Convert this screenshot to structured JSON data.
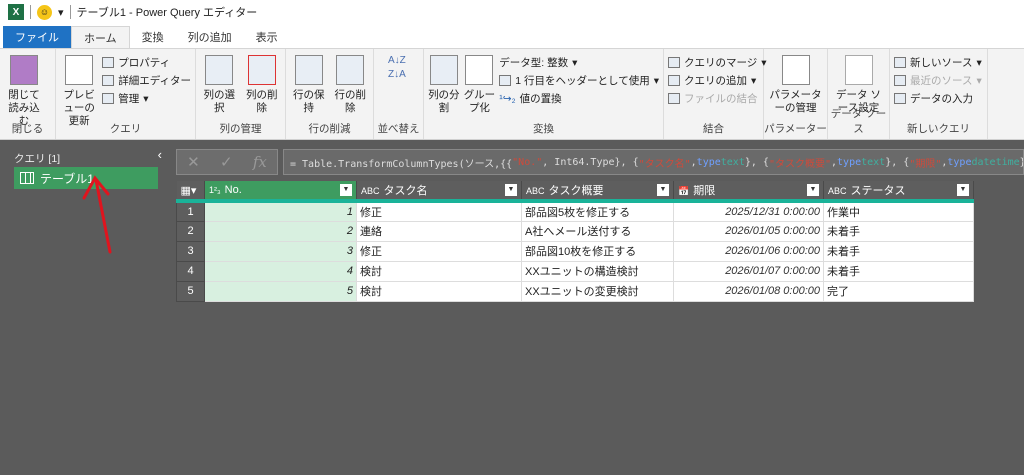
{
  "titlebar": {
    "title": "テーブル1 - Power Query エディター",
    "app_icon": "X"
  },
  "tabs": [
    "ファイル",
    "ホーム",
    "変換",
    "列の追加",
    "表示"
  ],
  "ribbon": {
    "close": {
      "btn": "閉じて読み込む",
      "label": "閉じる"
    },
    "query": {
      "preview": "プレビューの更新",
      "properties": "プロパティ",
      "advanced": "詳細エディター",
      "manage": "管理",
      "label": "クエリ"
    },
    "cols": {
      "choose": "列の選択",
      "remove": "列の削除",
      "label": "列の管理"
    },
    "rows": {
      "keep": "行の保持",
      "remove": "行の削除",
      "label": "行の削減"
    },
    "sort": {
      "label": "並べ替え"
    },
    "transform": {
      "split": "列の分割",
      "group": "グループ化",
      "datatype": "データ型: 整数",
      "header": "1 行目をヘッダーとして使用",
      "replace": "値の置換",
      "label": "変換"
    },
    "combine": {
      "merge": "クエリのマージ",
      "append": "クエリの追加",
      "files": "ファイルの結合",
      "label": "結合"
    },
    "params": {
      "manage": "パラメーターの管理",
      "label": "パラメーター"
    },
    "datasource": {
      "settings": "データ ソース設定",
      "label": "データ ソース"
    },
    "newquery": {
      "new": "新しいソース",
      "recent": "最近のソース",
      "enter": "データの入力",
      "label": "新しいクエリ"
    }
  },
  "queries": {
    "header": "クエリ [1]",
    "items": [
      "テーブル1"
    ]
  },
  "formula": "= Table.TransformColumnTypes(ソース,{{\"No.\", Int64.Type}, {\"タスク名\", type text}, {\"タスク概要\", type text}, {\"期限\", type datetime}, {\"ステータス\", type text}})",
  "table": {
    "columns": [
      {
        "type": "1²₃",
        "name": "No."
      },
      {
        "type": "ABC",
        "name": "タスク名"
      },
      {
        "type": "ABC",
        "name": "タスク概要"
      },
      {
        "type": "📅",
        "name": "期限"
      },
      {
        "type": "ABC",
        "name": "ステータス"
      }
    ],
    "rows": [
      [
        "1",
        "修正",
        "部品図5枚を修正する",
        "2025/12/31 0:00:00",
        "作業中"
      ],
      [
        "2",
        "連絡",
        "A社へメール送付する",
        "2026/01/05 0:00:00",
        "未着手"
      ],
      [
        "3",
        "修正",
        "部品図10枚を修正する",
        "2026/01/06 0:00:00",
        "未着手"
      ],
      [
        "4",
        "検討",
        "XXユニットの構造検討",
        "2026/01/07 0:00:00",
        "未着手"
      ],
      [
        "5",
        "検討",
        "XXユニットの変更検討",
        "2026/01/08 0:00:00",
        "完了"
      ]
    ]
  }
}
